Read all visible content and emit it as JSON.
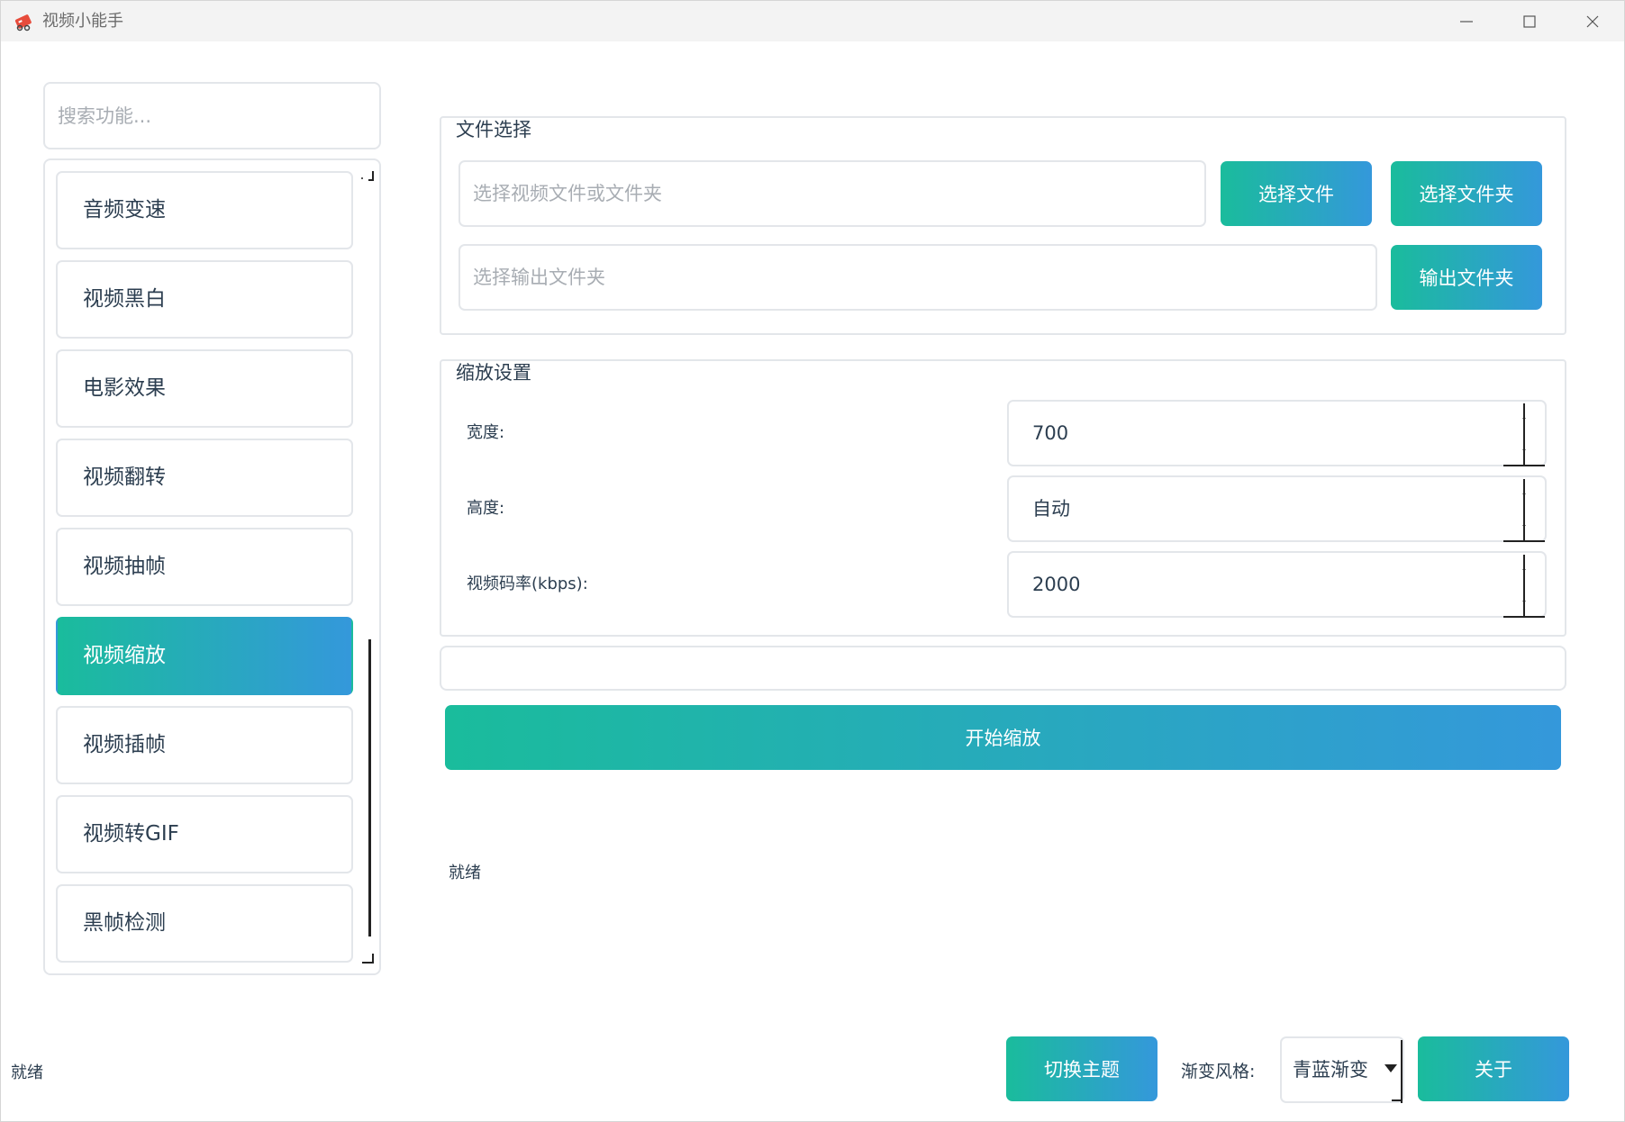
{
  "window": {
    "title": "视频小能手"
  },
  "sidebar": {
    "search_placeholder": "搜索功能...",
    "items": [
      {
        "label": "音频变速"
      },
      {
        "label": "视频黑白"
      },
      {
        "label": "电影效果"
      },
      {
        "label": "视频翻转"
      },
      {
        "label": "视频抽帧"
      },
      {
        "label": "视频缩放",
        "active": true
      },
      {
        "label": "视频插帧"
      },
      {
        "label": "视频转GIF"
      },
      {
        "label": "黑帧检测"
      }
    ]
  },
  "file_section": {
    "title": "文件选择",
    "input_placeholder": "选择视频文件或文件夹",
    "select_file_label": "选择文件",
    "select_folder_label": "选择文件夹",
    "output_placeholder": "选择输出文件夹",
    "output_folder_label": "输出文件夹"
  },
  "scale_section": {
    "title": "缩放设置",
    "width_label": "宽度:",
    "width_value": "700",
    "height_label": "高度:",
    "height_value": "自动",
    "bitrate_label": "视频码率(kbps):",
    "bitrate_value": "2000"
  },
  "progress": 0,
  "start_button_label": "开始缩放",
  "panel_status": "就绪",
  "footer": {
    "status": "就绪",
    "theme_button_label": "切换主题",
    "style_label": "渐变风格:",
    "style_value": "青蓝渐变",
    "about_label": "关于"
  },
  "colors": {
    "gradient_start": "#1abc9c",
    "gradient_end": "#3498db",
    "text": "#2c3e50",
    "border": "#e3e6ea"
  },
  "icons": {
    "app": "video-app-icon",
    "minimize": "minimize-icon",
    "maximize": "maximize-icon",
    "close": "close-icon",
    "spin_up": "chevron-up-icon",
    "spin_down": "chevron-down-icon",
    "dropdown": "dropdown-arrow-icon"
  }
}
